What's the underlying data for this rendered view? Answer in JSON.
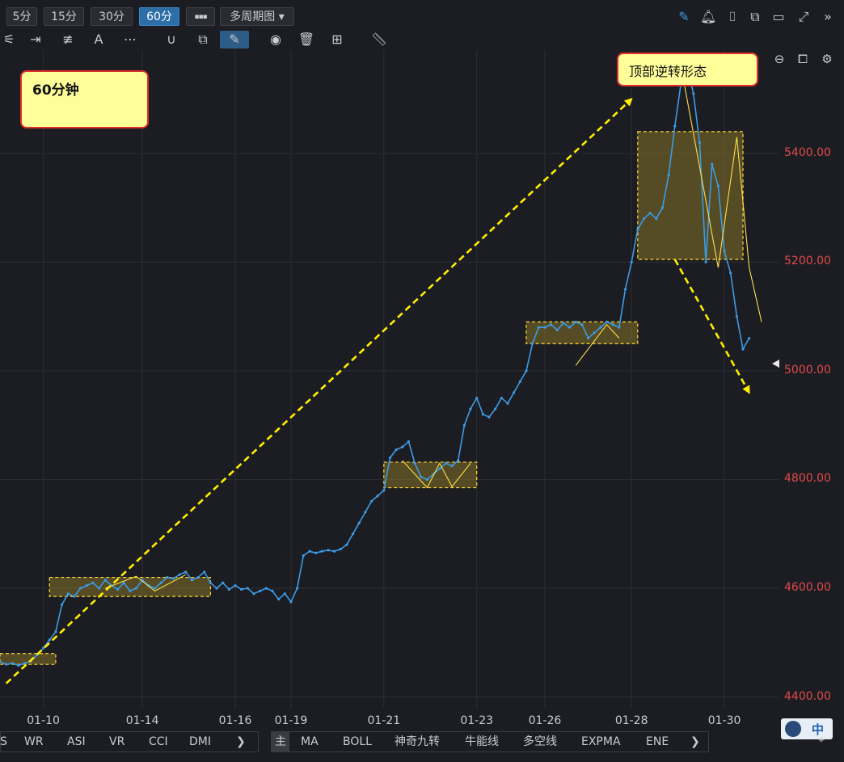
{
  "toolbar": {
    "timeframes": [
      "5分",
      "15分",
      "30分",
      "60分"
    ],
    "active_timeframe": "60分",
    "more_label": "▪▪▪",
    "multi_period": "多周期图 ▾"
  },
  "bottom_left_tabs": [
    "S",
    "WR",
    "ASI",
    "VR",
    "CCI",
    "DMI"
  ],
  "bottom_right_tabs": [
    "主",
    "MA",
    "BOLL",
    "神奇九转",
    "牛能线",
    "多空线",
    "EXPMA",
    "ENE"
  ],
  "callouts": {
    "left": "60分钟",
    "right": "顶部逆转形态"
  },
  "badge_text": "中",
  "chart_data": {
    "type": "line",
    "title": "",
    "xlabel": "",
    "ylabel": "",
    "ylim": [
      4380,
      5590
    ],
    "y_ticks": [
      "4400.00",
      "4600.00",
      "4800.00",
      "5000.00",
      "5200.00",
      "5400.00"
    ],
    "x_ticks": [
      "01-10",
      "01-14",
      "01-16",
      "01-19",
      "01-21",
      "01-23",
      "01-26",
      "01-28",
      "01-30"
    ],
    "x_tick_index": [
      7,
      23,
      38,
      47,
      62,
      77,
      88,
      102,
      117
    ],
    "line_color": "#3c9be6",
    "series": [
      {
        "values": [
          4465,
          4460,
          4462,
          4458,
          4462,
          4466,
          4478,
          4490,
          4505,
          4520,
          4570,
          4590,
          4585,
          4600,
          4605,
          4610,
          4600,
          4615,
          4605,
          4598,
          4610,
          4595,
          4600,
          4615,
          4605,
          4600,
          4610,
          4620,
          4618,
          4625,
          4630,
          4615,
          4620,
          4630,
          4610,
          4600,
          4610,
          4598,
          4605,
          4598,
          4600,
          4590,
          4595,
          4600,
          4595,
          4580,
          4590,
          4575,
          4600,
          4660,
          4668,
          4665,
          4668,
          4670,
          4668,
          4672,
          4680,
          4700,
          4720,
          4740,
          4760,
          4770,
          4780,
          4840,
          4855,
          4860,
          4870,
          4830,
          4805,
          4800,
          4810,
          4820,
          4830,
          4825,
          4835,
          4900,
          4930,
          4950,
          4920,
          4915,
          4930,
          4950,
          4940,
          4960,
          4980,
          5000,
          5050,
          5080,
          5080,
          5085,
          5075,
          5088,
          5080,
          5090,
          5085,
          5060,
          5070,
          5080,
          5090,
          5085,
          5080,
          5150,
          5200,
          5260,
          5280,
          5290,
          5280,
          5300,
          5360,
          5450,
          5530,
          5560,
          5510,
          5420,
          5200,
          5380,
          5340,
          5220,
          5180,
          5100,
          5040,
          5060
        ]
      }
    ],
    "annotation_boxes": [
      {
        "from": 0,
        "to": 9,
        "low": 4460,
        "high": 4480
      },
      {
        "from": 8,
        "to": 34,
        "low": 4585,
        "high": 4620
      },
      {
        "from": 62,
        "to": 77,
        "low": 4785,
        "high": 4832
      },
      {
        "from": 85,
        "to": 103,
        "low": 5050,
        "high": 5090
      },
      {
        "from": 103,
        "to": 120,
        "low": 5205,
        "high": 5440
      }
    ],
    "yellow_lines": [
      {
        "points": [
          [
            17,
            4600
          ],
          [
            22,
            4622
          ],
          [
            25,
            4595
          ],
          [
            30,
            4625
          ]
        ]
      },
      {
        "points": [
          [
            65,
            4835
          ],
          [
            69,
            4785
          ],
          [
            71,
            4830
          ],
          [
            73,
            4787
          ],
          [
            76,
            4830
          ]
        ]
      },
      {
        "points": [
          [
            93,
            5010
          ],
          [
            98,
            5085
          ],
          [
            100,
            5060
          ]
        ]
      },
      {
        "points": [
          [
            110,
            5560
          ],
          [
            116,
            5190
          ],
          [
            119,
            5430
          ],
          [
            121,
            5190
          ],
          [
            123,
            5090
          ]
        ]
      }
    ],
    "arrows": [
      {
        "from": [
          1,
          4425
        ],
        "to": [
          102,
          5500
        ]
      },
      {
        "from": [
          109,
          5205
        ],
        "to": [
          121,
          4960
        ]
      }
    ],
    "grid": true,
    "x_count": 124
  }
}
